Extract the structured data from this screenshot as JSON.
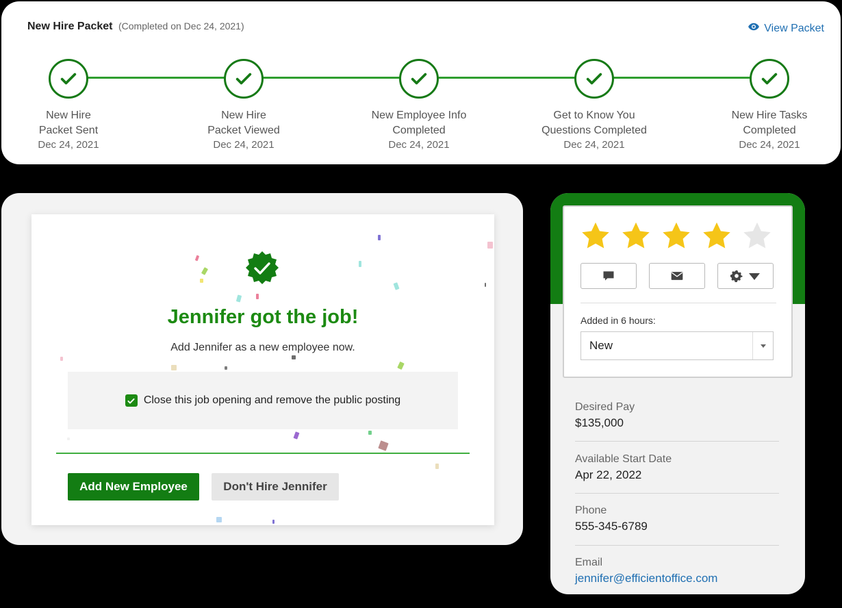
{
  "packet": {
    "title": "New Hire Packet",
    "subtitle": "(Completed on Dec 24, 2021)",
    "view_label": "View Packet",
    "steps": [
      {
        "line1": "New Hire",
        "line2": "Packet Sent",
        "date": "Dec 24, 2021"
      },
      {
        "line1": "New Hire",
        "line2": "Packet Viewed",
        "date": "Dec 24, 2021"
      },
      {
        "line1": "New Employee Info",
        "line2": "Completed",
        "date": "Dec 24, 2021"
      },
      {
        "line1": "Get to Know You",
        "line2": "Questions Completed",
        "date": "Dec 24, 2021"
      },
      {
        "line1": "New Hire Tasks",
        "line2": "Completed",
        "date": "Dec 24, 2021"
      }
    ],
    "accent": "#167a16"
  },
  "hire": {
    "title": "Jennifer got the job!",
    "subtitle": "Add Jennifer as a new employee now.",
    "checkbox_label": "Close this job opening and remove the public posting",
    "checkbox_checked": true,
    "add_button": "Add New Employee",
    "dont_button": "Don't Hire Jennifer",
    "brand_color": "#1c8a12"
  },
  "candidate": {
    "rating": 4,
    "rating_max": 5,
    "actions": [
      "comment-icon",
      "mail-icon",
      "gear-icon"
    ],
    "added_label": "Added in 6 hours:",
    "status_value": "New",
    "fields": [
      {
        "label": "Desired Pay",
        "value": "$135,000"
      },
      {
        "label": "Available Start Date",
        "value": "Apr 22, 2022"
      },
      {
        "label": "Phone",
        "value": "555-345-6789"
      },
      {
        "label": "Email",
        "value": "jennifer@efficientoffice.com"
      }
    ]
  }
}
